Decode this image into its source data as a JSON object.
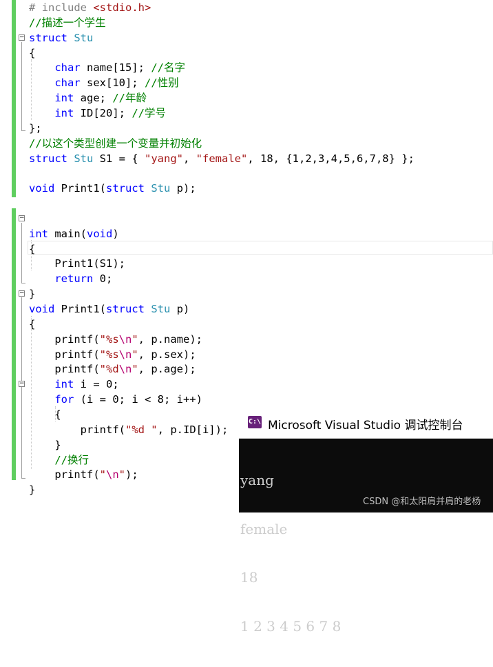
{
  "editor": {
    "lines": [
      [
        {
          "t": "# include ",
          "c": "pp"
        },
        {
          "t": "<stdio.h>",
          "c": "st"
        }
      ],
      [
        {
          "t": "//描述一个学生",
          "c": "cm"
        }
      ],
      [
        {
          "t": "struct",
          "c": "kw"
        },
        {
          "t": " "
        },
        {
          "t": "Stu",
          "c": "ty"
        }
      ],
      [
        {
          "t": "{"
        }
      ],
      [
        {
          "t": "    "
        },
        {
          "t": "char",
          "c": "kw"
        },
        {
          "t": " name[15]; "
        },
        {
          "t": "//名字",
          "c": "cm"
        }
      ],
      [
        {
          "t": "    "
        },
        {
          "t": "char",
          "c": "kw"
        },
        {
          "t": " sex[10]; "
        },
        {
          "t": "//性别",
          "c": "cm"
        }
      ],
      [
        {
          "t": "    "
        },
        {
          "t": "int",
          "c": "kw"
        },
        {
          "t": " age; "
        },
        {
          "t": "//年龄",
          "c": "cm"
        }
      ],
      [
        {
          "t": "    "
        },
        {
          "t": "int",
          "c": "kw"
        },
        {
          "t": " ID[20]; "
        },
        {
          "t": "//学号",
          "c": "cm"
        }
      ],
      [
        {
          "t": "};"
        }
      ],
      [
        {
          "t": "//以这个类型创建一个变量并初始化",
          "c": "cm"
        }
      ],
      [
        {
          "t": "struct",
          "c": "kw"
        },
        {
          "t": " "
        },
        {
          "t": "Stu",
          "c": "ty"
        },
        {
          "t": " S1 = { "
        },
        {
          "t": "\"yang\"",
          "c": "st"
        },
        {
          "t": ", "
        },
        {
          "t": "\"female\"",
          "c": "st"
        },
        {
          "t": ", 18, {1,2,3,4,5,6,7,8} };"
        }
      ],
      [
        {
          "t": ""
        }
      ],
      [
        {
          "t": "void",
          "c": "kw"
        },
        {
          "t": " Print1("
        },
        {
          "t": "struct",
          "c": "kw"
        },
        {
          "t": " "
        },
        {
          "t": "Stu",
          "c": "ty"
        },
        {
          "t": " p);"
        }
      ],
      [
        {
          "t": ""
        }
      ],
      [
        {
          "t": ""
        }
      ],
      [
        {
          "t": "int",
          "c": "kw"
        },
        {
          "t": " main("
        },
        {
          "t": "void",
          "c": "kw"
        },
        {
          "t": ")"
        }
      ],
      [
        {
          "t": "{"
        }
      ],
      [
        {
          "t": "    Print1(S1);"
        }
      ],
      [
        {
          "t": "    "
        },
        {
          "t": "return",
          "c": "kw"
        },
        {
          "t": " 0;"
        }
      ],
      [
        {
          "t": "}"
        }
      ],
      [
        {
          "t": "void",
          "c": "kw"
        },
        {
          "t": " Print1("
        },
        {
          "t": "struct",
          "c": "kw"
        },
        {
          "t": " "
        },
        {
          "t": "Stu",
          "c": "ty"
        },
        {
          "t": " p)"
        }
      ],
      [
        {
          "t": "{"
        }
      ],
      [
        {
          "t": "    printf("
        },
        {
          "t": "\"%s",
          "c": "st"
        },
        {
          "t": "\\n",
          "c": "esc"
        },
        {
          "t": "\"",
          "c": "st"
        },
        {
          "t": ", p.name);"
        }
      ],
      [
        {
          "t": "    printf("
        },
        {
          "t": "\"%s",
          "c": "st"
        },
        {
          "t": "\\n",
          "c": "esc"
        },
        {
          "t": "\"",
          "c": "st"
        },
        {
          "t": ", p.sex);"
        }
      ],
      [
        {
          "t": "    printf("
        },
        {
          "t": "\"%d",
          "c": "st"
        },
        {
          "t": "\\n",
          "c": "esc"
        },
        {
          "t": "\"",
          "c": "st"
        },
        {
          "t": ", p.age);"
        }
      ],
      [
        {
          "t": "    "
        },
        {
          "t": "int",
          "c": "kw"
        },
        {
          "t": " i = 0;"
        }
      ],
      [
        {
          "t": "    "
        },
        {
          "t": "for",
          "c": "kw"
        },
        {
          "t": " (i = 0; i < 8; i++)"
        }
      ],
      [
        {
          "t": "    {"
        }
      ],
      [
        {
          "t": "        printf("
        },
        {
          "t": "\"%d \"",
          "c": "st"
        },
        {
          "t": ", p.ID[i]);"
        }
      ],
      [
        {
          "t": "    }"
        }
      ],
      [
        {
          "t": "    "
        },
        {
          "t": "//换行",
          "c": "cm"
        }
      ],
      [
        {
          "t": "    printf("
        },
        {
          "t": "\"",
          "c": "st"
        },
        {
          "t": "\\n",
          "c": "esc"
        },
        {
          "t": "\"",
          "c": "st"
        },
        {
          "t": ");"
        }
      ],
      [
        {
          "t": "}"
        }
      ]
    ]
  },
  "console": {
    "icon_text": "C:\\",
    "title": "Microsoft Visual Studio 调试控制台",
    "output": [
      "yang",
      "female",
      "18",
      "1 2 3 4 5 6 7 8"
    ]
  },
  "watermark": "CSDN @和太阳肩并肩的老杨",
  "colors": {
    "keyword": "#0000ff",
    "type": "#2b91af",
    "comment": "#008000",
    "string": "#a31515",
    "escape": "#b5006f",
    "change_bar": "#5fce5f",
    "console_bg": "#0c0c0c",
    "console_icon": "#68217a"
  }
}
